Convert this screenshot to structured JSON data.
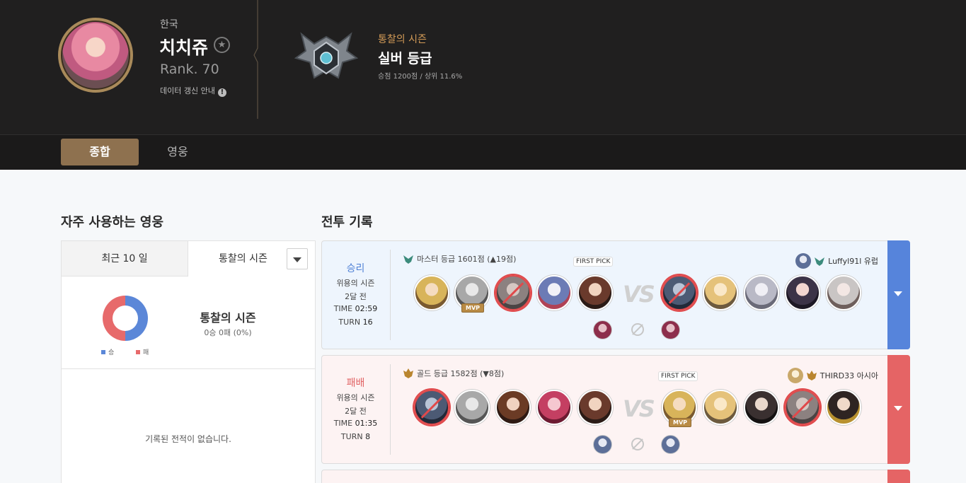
{
  "profile": {
    "region": "한국",
    "name": "치치쥬",
    "rank": "Rank. 70",
    "update_notice": "데이터 갱신 안내",
    "info_glyph": "!",
    "star_glyph": "★"
  },
  "season": {
    "label": "통찰의 시즌",
    "tier": "실버 등급",
    "detail": "승점 1200점 / 상위 11.6%"
  },
  "tabs": [
    {
      "label": "종합",
      "active": true
    },
    {
      "label": "영웅",
      "active": false
    }
  ],
  "frequent_heroes": {
    "title": "자주 사용하는 영웅",
    "tab_recent": "최근 10 일",
    "tab_season": "통찰의 시즌",
    "legend_win": "승",
    "legend_lose": "패",
    "stat_title": "통찰의 시즌",
    "stat_sub": "0승 0패 (0%)",
    "empty_message": "기록된 전적이 없습니다.",
    "colors": {
      "win": "#5b87d8",
      "lose": "#e76a6b"
    }
  },
  "battle_records": {
    "title": "전투 기록",
    "items": [
      {
        "result": "승리",
        "season": "위용의 시즌",
        "ago": "2달 전",
        "time_label": "TIME",
        "time": "02:59",
        "turn_label": "TURN",
        "turn": "16",
        "opponent_tier": "마스터 등급 1601점 (",
        "opponent_delta_glyph": "▲",
        "opponent_delta": "19점)",
        "me_name": "Luffyl91l",
        "me_region": "유럽",
        "first_pick": "FIRST PICK",
        "vs": "VS",
        "mvp": "MVP",
        "color": "#5684db"
      },
      {
        "result": "패배",
        "season": "위용의 시즌",
        "ago": "2달 전",
        "time_label": "TIME",
        "time": "01:35",
        "turn_label": "TURN",
        "turn": "8",
        "opponent_tier": "골드 등급 1582점 (",
        "opponent_delta_glyph": "▼",
        "opponent_delta": "8점)",
        "me_name": "THIRD33",
        "me_region": "아시아",
        "first_pick": "FIRST PICK",
        "vs": "VS",
        "mvp": "MVP",
        "color": "#e56465"
      }
    ]
  }
}
